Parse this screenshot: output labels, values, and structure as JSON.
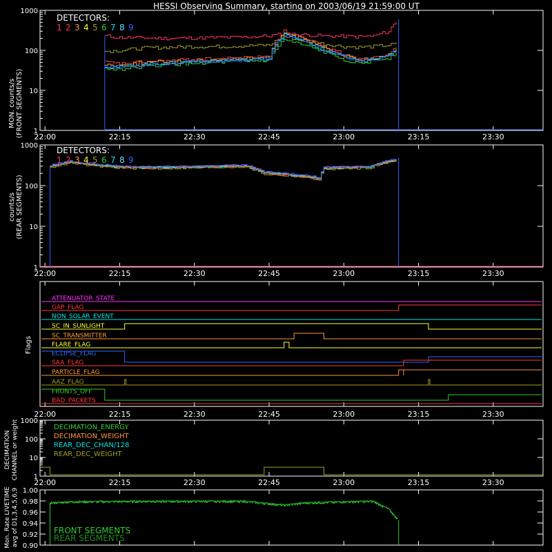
{
  "title": "HESSI Observing Summary, starting on 2003/06/19 21:59:00 UT",
  "colors": {
    "d1": "#ff3366",
    "d2": "#ff3b3b",
    "d3": "#ff9933",
    "d4": "#ffff33",
    "d5": "#a0a020",
    "d6": "#33cc33",
    "d7": "#00e6e6",
    "d8": "#66ddff",
    "d9": "#3366ff",
    "axis": "#ffffff"
  },
  "x_tick_labels": [
    "22:00",
    "22:15",
    "22:30",
    "22:45",
    "23:00",
    "23:15",
    "23:30"
  ],
  "panels": {
    "front": {
      "ylabel": [
        "MON. counts/s",
        "(FRONT SEGMENTS)"
      ],
      "yticks": [
        "1",
        "10",
        "100",
        "1000"
      ],
      "legend_title": "DETECTORS:",
      "legend_numbers": [
        "1",
        "2",
        "3",
        "4",
        "5",
        "6",
        "7",
        "8",
        "9"
      ]
    },
    "rear": {
      "ylabel": [
        "counts/s",
        "(REAR SEGMENTS)"
      ],
      "yticks": [
        "1",
        "10",
        "100",
        "1000"
      ],
      "legend_title": "DETECTORS:",
      "legend_numbers": [
        "1",
        "2",
        "3",
        "4",
        "5",
        "6",
        "7",
        "8",
        "9"
      ]
    },
    "flags": {
      "ylabel": "Flags",
      "labels": [
        "ATTENUATOR_STATE",
        "GAP_FLAG",
        "NON_SOLAR_EVENT",
        "SC_IN_SUNLIGHT",
        "SC_TRANSMITTER",
        "FLARE_FLAG",
        "ECLIPSE_FLAG",
        "SAA_FLAG",
        "PARTICLE_FLAG",
        "AAZ_FLAG",
        "FRONTS_OFF",
        "BAD_PACKETS"
      ]
    },
    "decim": {
      "ylabel": [
        "DECIMATION",
        "CHANNEL or weight"
      ],
      "yticks": [
        "1",
        "10",
        "100",
        "1000"
      ],
      "legend": [
        "DECIMATION_ENERGY",
        "DECIMATION_WEIGHT",
        "REAR_DEC_CHAN/128",
        "REAR_DEC_WEIGHT"
      ]
    },
    "live": {
      "ylabel": [
        "Mon. Rate LIVETIME",
        "avg of D1,3,4,5,6,9"
      ],
      "yticks": [
        "0.90",
        "0.92",
        "0.94",
        "0.96",
        "0.98",
        "1.00"
      ],
      "legend": [
        "FRONT SEGMENTS",
        "REAR SEGMENTS"
      ]
    }
  },
  "chart_data": [
    {
      "type": "line",
      "ylabel": "MON. counts/s (FRONT SEGMENTS)",
      "ylog": true,
      "ylim": [
        1,
        1000
      ],
      "xlim": [
        "21:59",
        "23:40"
      ],
      "x": [
        "22:12",
        "22:15",
        "22:20",
        "22:25",
        "22:30",
        "22:35",
        "22:40",
        "22:45",
        "22:48",
        "22:52",
        "22:56",
        "23:00",
        "23:03",
        "23:06",
        "23:09",
        "23:11"
      ],
      "series": [
        {
          "name": "1",
          "values": [
            230,
            210,
            205,
            200,
            205,
            210,
            215,
            230,
            260,
            245,
            230,
            225,
            220,
            230,
            300,
            600
          ]
        },
        {
          "name": "2",
          "values": [
            50,
            46,
            52,
            55,
            60,
            62,
            65,
            70,
            300,
            190,
            120,
            80,
            60,
            70,
            85,
            120
          ]
        },
        {
          "name": "3",
          "values": [
            45,
            42,
            50,
            52,
            56,
            60,
            62,
            66,
            280,
            180,
            110,
            75,
            55,
            65,
            80,
            115
          ]
        },
        {
          "name": "5",
          "values": [
            95,
            100,
            115,
            120,
            125,
            125,
            130,
            135,
            220,
            175,
            145,
            125,
            120,
            125,
            135,
            150
          ]
        },
        {
          "name": "6",
          "values": [
            35,
            34,
            40,
            44,
            48,
            50,
            53,
            56,
            180,
            130,
            90,
            60,
            47,
            55,
            65,
            95
          ]
        },
        {
          "name": "7",
          "values": [
            40,
            38,
            45,
            48,
            52,
            55,
            58,
            62,
            250,
            160,
            100,
            70,
            52,
            60,
            75,
            110
          ]
        },
        {
          "name": "9",
          "values": [
            40,
            38,
            45,
            48,
            52,
            55,
            58,
            62,
            250,
            160,
            100,
            70,
            52,
            60,
            75,
            110
          ]
        }
      ]
    },
    {
      "type": "line",
      "ylabel": "counts/s (REAR SEGMENTS)",
      "ylog": true,
      "ylim": [
        1,
        1000
      ],
      "xlim": [
        "21:59",
        "23:40"
      ],
      "x": [
        "22:01",
        "22:05",
        "22:10",
        "22:15",
        "22:20",
        "22:30",
        "22:40",
        "22:44",
        "22:50",
        "22:55",
        "22:56",
        "23:00",
        "23:05",
        "23:10",
        "23:11"
      ],
      "series": [
        {
          "name": "1",
          "values": [
            300,
            380,
            320,
            290,
            280,
            290,
            310,
            210,
            180,
            150,
            270,
            280,
            290,
            420,
            480
          ]
        },
        {
          "name": "5",
          "values": [
            280,
            360,
            300,
            270,
            260,
            270,
            290,
            190,
            170,
            140,
            250,
            260,
            270,
            400,
            460
          ]
        },
        {
          "name": "9",
          "values": [
            310,
            400,
            340,
            300,
            290,
            300,
            320,
            220,
            190,
            160,
            280,
            290,
            300,
            440,
            500
          ]
        }
      ]
    },
    {
      "type": "line",
      "ylabel": "Flags",
      "series": [
        {
          "name": "SC_IN_SUNLIGHT",
          "values": [
            [
              0,
              0
            ],
            [
              1,
              1
            ],
            [
              0,
              0
            ]
          ]
        },
        {
          "name": "FLARE_FLAG",
          "values": [
            [
              0,
              0
            ],
            [
              1,
              1
            ],
            [
              0,
              0
            ]
          ]
        }
      ]
    },
    {
      "type": "line",
      "ylabel": "DECIMATION CHANNEL or weight",
      "ylog": true,
      "ylim": [
        1,
        1000
      ],
      "xlim": [
        "21:59",
        "23:40"
      ],
      "series": [
        {
          "name": "DECIMATION_ENERGY",
          "values": [
            3,
            0,
            3,
            0
          ]
        },
        {
          "name": "REAR_DEC_WEIGHT",
          "values": [
            1,
            1,
            1,
            1
          ]
        }
      ]
    },
    {
      "type": "line",
      "ylabel": "Mon. Rate LIVETIME avg of D1,3,4,5,6,9",
      "ylim": [
        0.9,
        1.0
      ],
      "xlim": [
        "21:59",
        "23:40"
      ],
      "x": [
        "22:01",
        "22:05",
        "22:20",
        "22:40",
        "22:48",
        "22:52",
        "23:00",
        "23:06",
        "23:09",
        "23:11"
      ],
      "series": [
        {
          "name": "FRONT SEGMENTS",
          "values": [
            0.976,
            0.978,
            0.979,
            0.979,
            0.972,
            0.976,
            0.978,
            0.979,
            0.965,
            0.945
          ]
        }
      ]
    }
  ]
}
